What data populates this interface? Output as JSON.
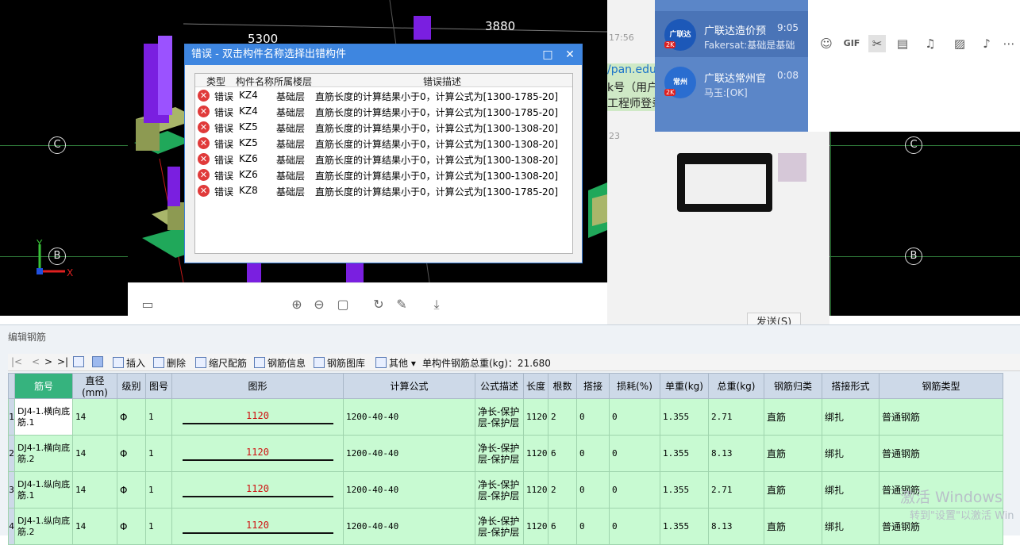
{
  "cad": {
    "axis_labels": [
      "C",
      "B",
      "C",
      "B"
    ],
    "dimensions": [
      "5300",
      "3880"
    ],
    "ucs": {
      "y": "Y",
      "x": "X"
    }
  },
  "error_dialog": {
    "title": "错误 - 双击构件名称选择出错构件",
    "columns": [
      "类型",
      "构件名称",
      "所属楼层",
      "错误描述"
    ],
    "rows": [
      {
        "type": "错误",
        "name": "KZ4",
        "floor": "基础层",
        "desc": "直筋长度的计算结果小于0，计算公式为[1300-1785-20]"
      },
      {
        "type": "错误",
        "name": "KZ4",
        "floor": "基础层",
        "desc": "直筋长度的计算结果小于0，计算公式为[1300-1785-20]"
      },
      {
        "type": "错误",
        "name": "KZ5",
        "floor": "基础层",
        "desc": "直筋长度的计算结果小于0，计算公式为[1300-1308-20]"
      },
      {
        "type": "错误",
        "name": "KZ5",
        "floor": "基础层",
        "desc": "直筋长度的计算结果小于0，计算公式为[1300-1308-20]"
      },
      {
        "type": "错误",
        "name": "KZ6",
        "floor": "基础层",
        "desc": "直筋长度的计算结果小于0，计算公式为[1300-1308-20]"
      },
      {
        "type": "错误",
        "name": "KZ6",
        "floor": "基础层",
        "desc": "直筋长度的计算结果小于0，计算公式为[1300-1308-20]"
      },
      {
        "type": "错误",
        "name": "KZ8",
        "floor": "基础层",
        "desc": "直筋长度的计算结果小于0，计算公式为[1300-1785-20]"
      }
    ]
  },
  "chat": {
    "timestamps": [
      "17:56",
      "23"
    ],
    "fragments": [
      "/pan.edu",
      "k号（用户",
      "工程师登录"
    ],
    "send_label": "发送(S)",
    "sessions": [
      {
        "name": "广联达造价预",
        "time": "9:05",
        "msg": "Fakersat:基础是基础",
        "avatar": "广联达",
        "badge": "2K"
      },
      {
        "name": "广联达常州官",
        "time": "0:08",
        "msg": "马玉:[OK]",
        "avatar": "常州",
        "badge": "2K"
      }
    ],
    "input_icons": [
      "emoji-icon",
      "gif-icon",
      "scissors-icon",
      "folder-icon",
      "music-icon",
      "image-icon",
      "bell-icon",
      "more-icon"
    ]
  },
  "editor": {
    "title": "编辑钢筋",
    "toolbar": {
      "nav": [
        "|<",
        "<",
        ">",
        ">|"
      ],
      "insert": "插入",
      "delete": "删除",
      "scale": "缩尺配筋",
      "info": "钢筋信息",
      "library": "钢筋图库",
      "other": "其他",
      "total_label": "单构件钢筋总重(kg)：21.680"
    },
    "columns": [
      "筋号",
      "直径(mm)",
      "级别",
      "图号",
      "图形",
      "计算公式",
      "公式描述",
      "长度",
      "根数",
      "搭接",
      "损耗(%)",
      "单重(kg)",
      "总重(kg)",
      "钢筋归类",
      "搭接形式",
      "钢筋类型"
    ],
    "rows": [
      {
        "no": "1",
        "name": "DJ4-1.横向底筋.1",
        "dia": "14",
        "grade": "Φ",
        "fig": "1",
        "shape": "1120",
        "formula": "1200-40-40",
        "desc": "净长-保护层-保护层",
        "len": "1120",
        "count": "2",
        "lap": "0",
        "loss": "0",
        "unit": "1.355",
        "total": "2.71",
        "cat": "直筋",
        "laptype": "绑扎",
        "type": "普通钢筋"
      },
      {
        "no": "2",
        "name": "DJ4-1.横向底筋.2",
        "dia": "14",
        "grade": "Φ",
        "fig": "1",
        "shape": "1120",
        "formula": "1200-40-40",
        "desc": "净长-保护层-保护层",
        "len": "1120",
        "count": "6",
        "lap": "0",
        "loss": "0",
        "unit": "1.355",
        "total": "8.13",
        "cat": "直筋",
        "laptype": "绑扎",
        "type": "普通钢筋"
      },
      {
        "no": "3",
        "name": "DJ4-1.纵向底筋.1",
        "dia": "14",
        "grade": "Φ",
        "fig": "1",
        "shape": "1120",
        "formula": "1200-40-40",
        "desc": "净长-保护层-保护层",
        "len": "1120",
        "count": "2",
        "lap": "0",
        "loss": "0",
        "unit": "1.355",
        "total": "2.71",
        "cat": "直筋",
        "laptype": "绑扎",
        "type": "普通钢筋"
      },
      {
        "no": "4",
        "name": "DJ4-1.纵向底筋.2",
        "dia": "14",
        "grade": "Φ",
        "fig": "1",
        "shape": "1120",
        "formula": "1200-40-40",
        "desc": "净长-保护层-保护层",
        "len": "1120",
        "count": "6",
        "lap": "0",
        "loss": "0",
        "unit": "1.355",
        "total": "8.13",
        "cat": "直筋",
        "laptype": "绑扎",
        "type": "普通钢筋"
      }
    ]
  },
  "watermark": {
    "line1": "激活 Windows",
    "line2": "转到\"设置\"以激活 Win"
  }
}
